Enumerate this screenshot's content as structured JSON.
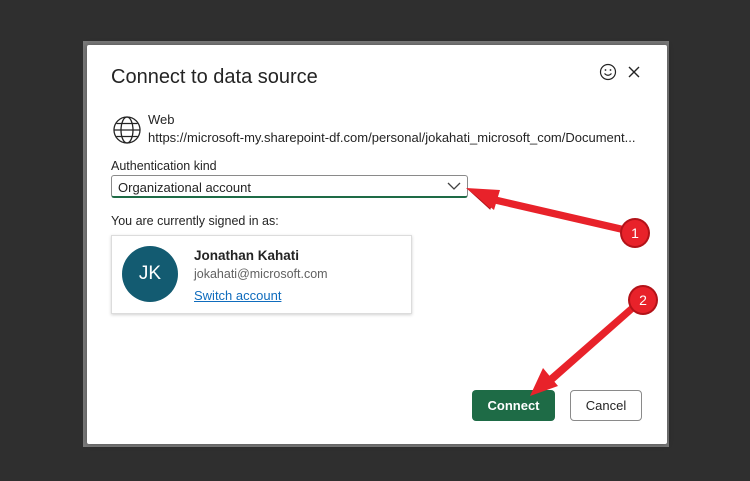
{
  "dialog": {
    "title": "Connect to data source",
    "feedback_icon": "smiley-icon",
    "close_icon": "close-icon"
  },
  "source": {
    "icon": "globe-icon",
    "kind": "Web",
    "url": "https://microsoft-my.sharepoint-df.com/personal/jokahati_microsoft_com/Document..."
  },
  "auth": {
    "label": "Authentication kind",
    "selected": "Organizational account"
  },
  "signed_in": {
    "label": "You are currently signed in as:",
    "initials": "JK",
    "name": "Jonathan Kahati",
    "email": "jokahati@microsoft.com",
    "switch_label": "Switch account"
  },
  "buttons": {
    "connect": "Connect",
    "cancel": "Cancel"
  },
  "annotations": {
    "badge1": "1",
    "badge2": "2",
    "color": "#e8222a"
  },
  "colors": {
    "accent": "#1e6b46",
    "avatar": "#135b71",
    "link": "#0f6cbd"
  }
}
